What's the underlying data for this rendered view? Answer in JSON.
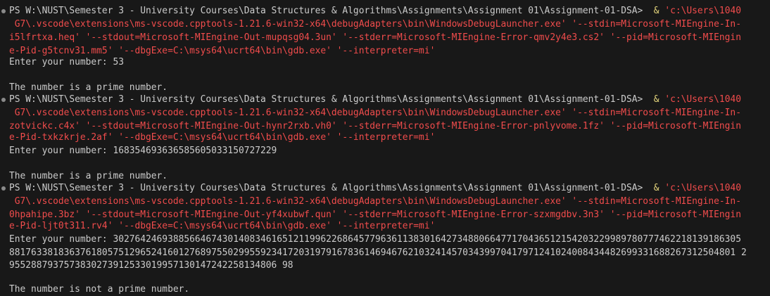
{
  "colors": {
    "background": "#181818",
    "text": "#cccccc",
    "string": "#f14c4c",
    "command": "#e6d77d"
  },
  "runs": [
    {
      "prompt": "PS W:\\NUST\\Semester 3 - University Courses\\Data Structures & Algorithms\\Assignments\\Assignment 01\\Assignment-01-DSA> ",
      "ampersand": " &",
      "cmd_lines": [
        "'c:\\Users\\1040",
        " G7\\.vscode\\extensions\\ms-vscode.cpptools-1.21.6-win32-x64\\debugAdapters\\bin\\WindowsDebugLauncher.exe' '--stdin=Microsoft-MIEngine-In-",
        "i5lfrtxa.heq' '--stdout=Microsoft-MIEngine-Out-mupqsg04.3un' '--stderr=Microsoft-MIEngine-Error-qmv2y4e3.cs2' '--pid=Microsoft-MIEngin",
        "e-Pid-g5tcnv31.mm5' '--dbgExe=C:\\msys64\\ucrt64\\bin\\gdb.exe' '--interpreter=mi'"
      ],
      "input_lines": [
        "Enter your number: 53"
      ],
      "result": "The number is a prime number."
    },
    {
      "prompt": "PS W:\\NUST\\Semester 3 - University Courses\\Data Structures & Algorithms\\Assignments\\Assignment 01\\Assignment-01-DSA> ",
      "ampersand": " &",
      "cmd_lines": [
        "'c:\\Users\\1040",
        " G7\\.vscode\\extensions\\ms-vscode.cpptools-1.21.6-win32-x64\\debugAdapters\\bin\\WindowsDebugLauncher.exe' '--stdin=Microsoft-MIEngine-In-",
        "zotvickc.c4x' '--stdout=Microsoft-MIEngine-Out-hynr2rxb.vh0' '--stderr=Microsoft-MIEngine-Error-pnlyvome.1fz' '--pid=Microsoft-MIEngin",
        "e-Pid-txkzkrje.2af' '--dbgExe=C:\\msys64\\ucrt64\\bin\\gdb.exe' '--interpreter=mi'"
      ],
      "input_lines": [
        "Enter your number: 168354693636585605033150727229"
      ],
      "result": "The number is a prime number."
    },
    {
      "prompt": "PS W:\\NUST\\Semester 3 - University Courses\\Data Structures & Algorithms\\Assignments\\Assignment 01\\Assignment-01-DSA> ",
      "ampersand": " &",
      "cmd_lines": [
        "'c:\\Users\\1040",
        " G7\\.vscode\\extensions\\ms-vscode.cpptools-1.21.6-win32-x64\\debugAdapters\\bin\\WindowsDebugLauncher.exe' '--stdin=Microsoft-MIEngine-In-",
        "0hpahipe.3bz' '--stdout=Microsoft-MIEngine-Out-yf4xubwf.qun' '--stderr=Microsoft-MIEngine-Error-szxmgdbv.3n3' '--pid=Microsoft-MIEngin",
        "e-Pid-ljt0t311.rv4' '--dbgExe=C:\\msys64\\ucrt64\\bin\\gdb.exe' '--interpreter=mi'"
      ],
      "input_lines": [
        "Enter your number: 3027642469388566467430140834616512119962268645779636113830164273488066477170436512154203229989780777462218139186305",
        "8817633818363761805751296524160127689755029955923417203197916783614694676210324145703439970417971241024008434482699331688267312504801 2",
        "9552887937573830273912533019957130147242258134806 98"
      ],
      "result": "The number is not a prime number."
    }
  ]
}
